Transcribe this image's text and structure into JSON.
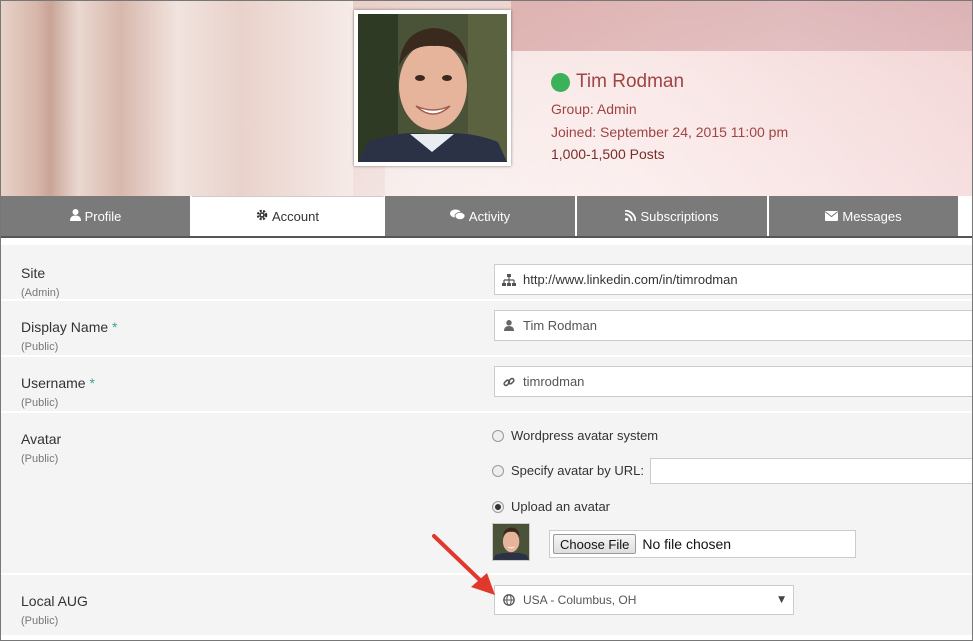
{
  "user": {
    "name": "Tim Rodman",
    "group": "Group: Admin",
    "joined": "Joined: September 24, 2015 11:00 pm",
    "posts": "1,000-1,500 Posts",
    "status_color": "#3bb25a"
  },
  "tabs": [
    {
      "label": "Profile",
      "icon": "user-icon",
      "active": false
    },
    {
      "label": "Account",
      "icon": "gear-icon",
      "active": true
    },
    {
      "label": "Activity",
      "icon": "comments-icon",
      "active": false
    },
    {
      "label": "Subscriptions",
      "icon": "rss-icon",
      "active": false
    },
    {
      "label": "Messages",
      "icon": "envelope-icon",
      "active": false
    }
  ],
  "form": {
    "site": {
      "label": "Site",
      "visibility": "(Admin)",
      "value": "http://www.linkedin.com/in/timrodman",
      "icon": "sitemap-icon"
    },
    "display_name": {
      "label": "Display Name",
      "required": "*",
      "visibility": "(Public)",
      "value": "Tim Rodman",
      "icon": "user-icon"
    },
    "username": {
      "label": "Username",
      "required": "*",
      "visibility": "(Public)",
      "value": "timrodman",
      "icon": "link-icon"
    },
    "avatar": {
      "label": "Avatar",
      "visibility": "(Public)",
      "options": [
        "Wordpress avatar system",
        "Specify avatar by URL:",
        "Upload an avatar"
      ],
      "selected_index": 2,
      "file_button": "Choose File",
      "file_status": "No file chosen"
    },
    "local_aug": {
      "label": "Local AUG",
      "visibility": "(Public)",
      "value": "USA - Columbus, OH",
      "icon": "globe-icon"
    }
  },
  "colors": {
    "accent_name": "#a04444",
    "tab_bg": "#7a7a7a",
    "arrow": "#e0392c"
  }
}
